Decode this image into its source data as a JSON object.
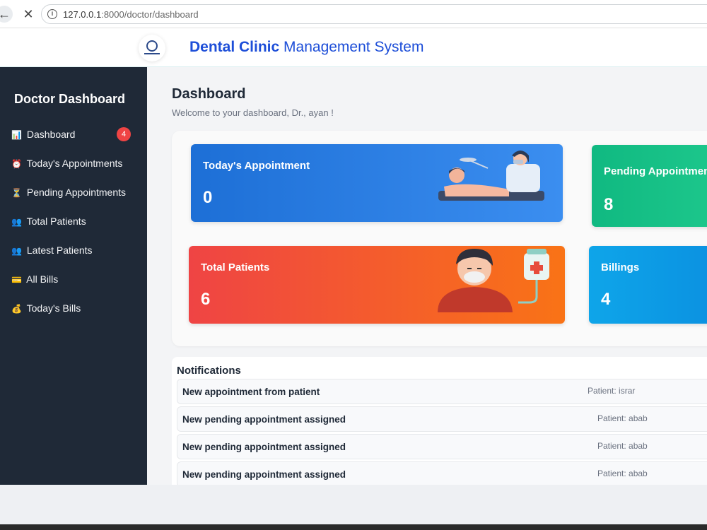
{
  "browser": {
    "url_host": "127.0.0.1",
    "url_rest": ":8000/doctor/dashboard"
  },
  "header": {
    "title_bold": "Dental Clinic",
    "title_rest": " Management System"
  },
  "sidebar": {
    "title": "Doctor Dashboard",
    "items": [
      {
        "icon": "📊",
        "label": "Dashboard",
        "badge": "4"
      },
      {
        "icon": "⏰",
        "label": "Today's Appointments"
      },
      {
        "icon": "⏳",
        "label": "Pending Appointments"
      },
      {
        "icon": "👥",
        "label": "Total Patients"
      },
      {
        "icon": "👥",
        "label": "Latest Patients"
      },
      {
        "icon": "💳",
        "label": "All Bills"
      },
      {
        "icon": "💰",
        "label": "Today's Bills"
      }
    ]
  },
  "main": {
    "title": "Dashboard",
    "subtitle": "Welcome to your dashboard, Dr., ayan !"
  },
  "cards": {
    "appointment": {
      "title": "Today's Appointment",
      "value": "0"
    },
    "pending": {
      "title": "Pending Appointments",
      "value": "8"
    },
    "patients": {
      "title": "Total Patients",
      "value": "6"
    },
    "billings": {
      "title": "Billings",
      "value": "4"
    }
  },
  "notifications": {
    "title": "Notifications",
    "items": [
      {
        "message": "New appointment from patient",
        "patient": "Patient: israr"
      },
      {
        "message": "New pending appointment assigned",
        "patient": "Patient: abab"
      },
      {
        "message": "New pending appointment assigned",
        "patient": "Patient: abab"
      },
      {
        "message": "New pending appointment assigned",
        "patient": "Patient: abab"
      }
    ]
  }
}
